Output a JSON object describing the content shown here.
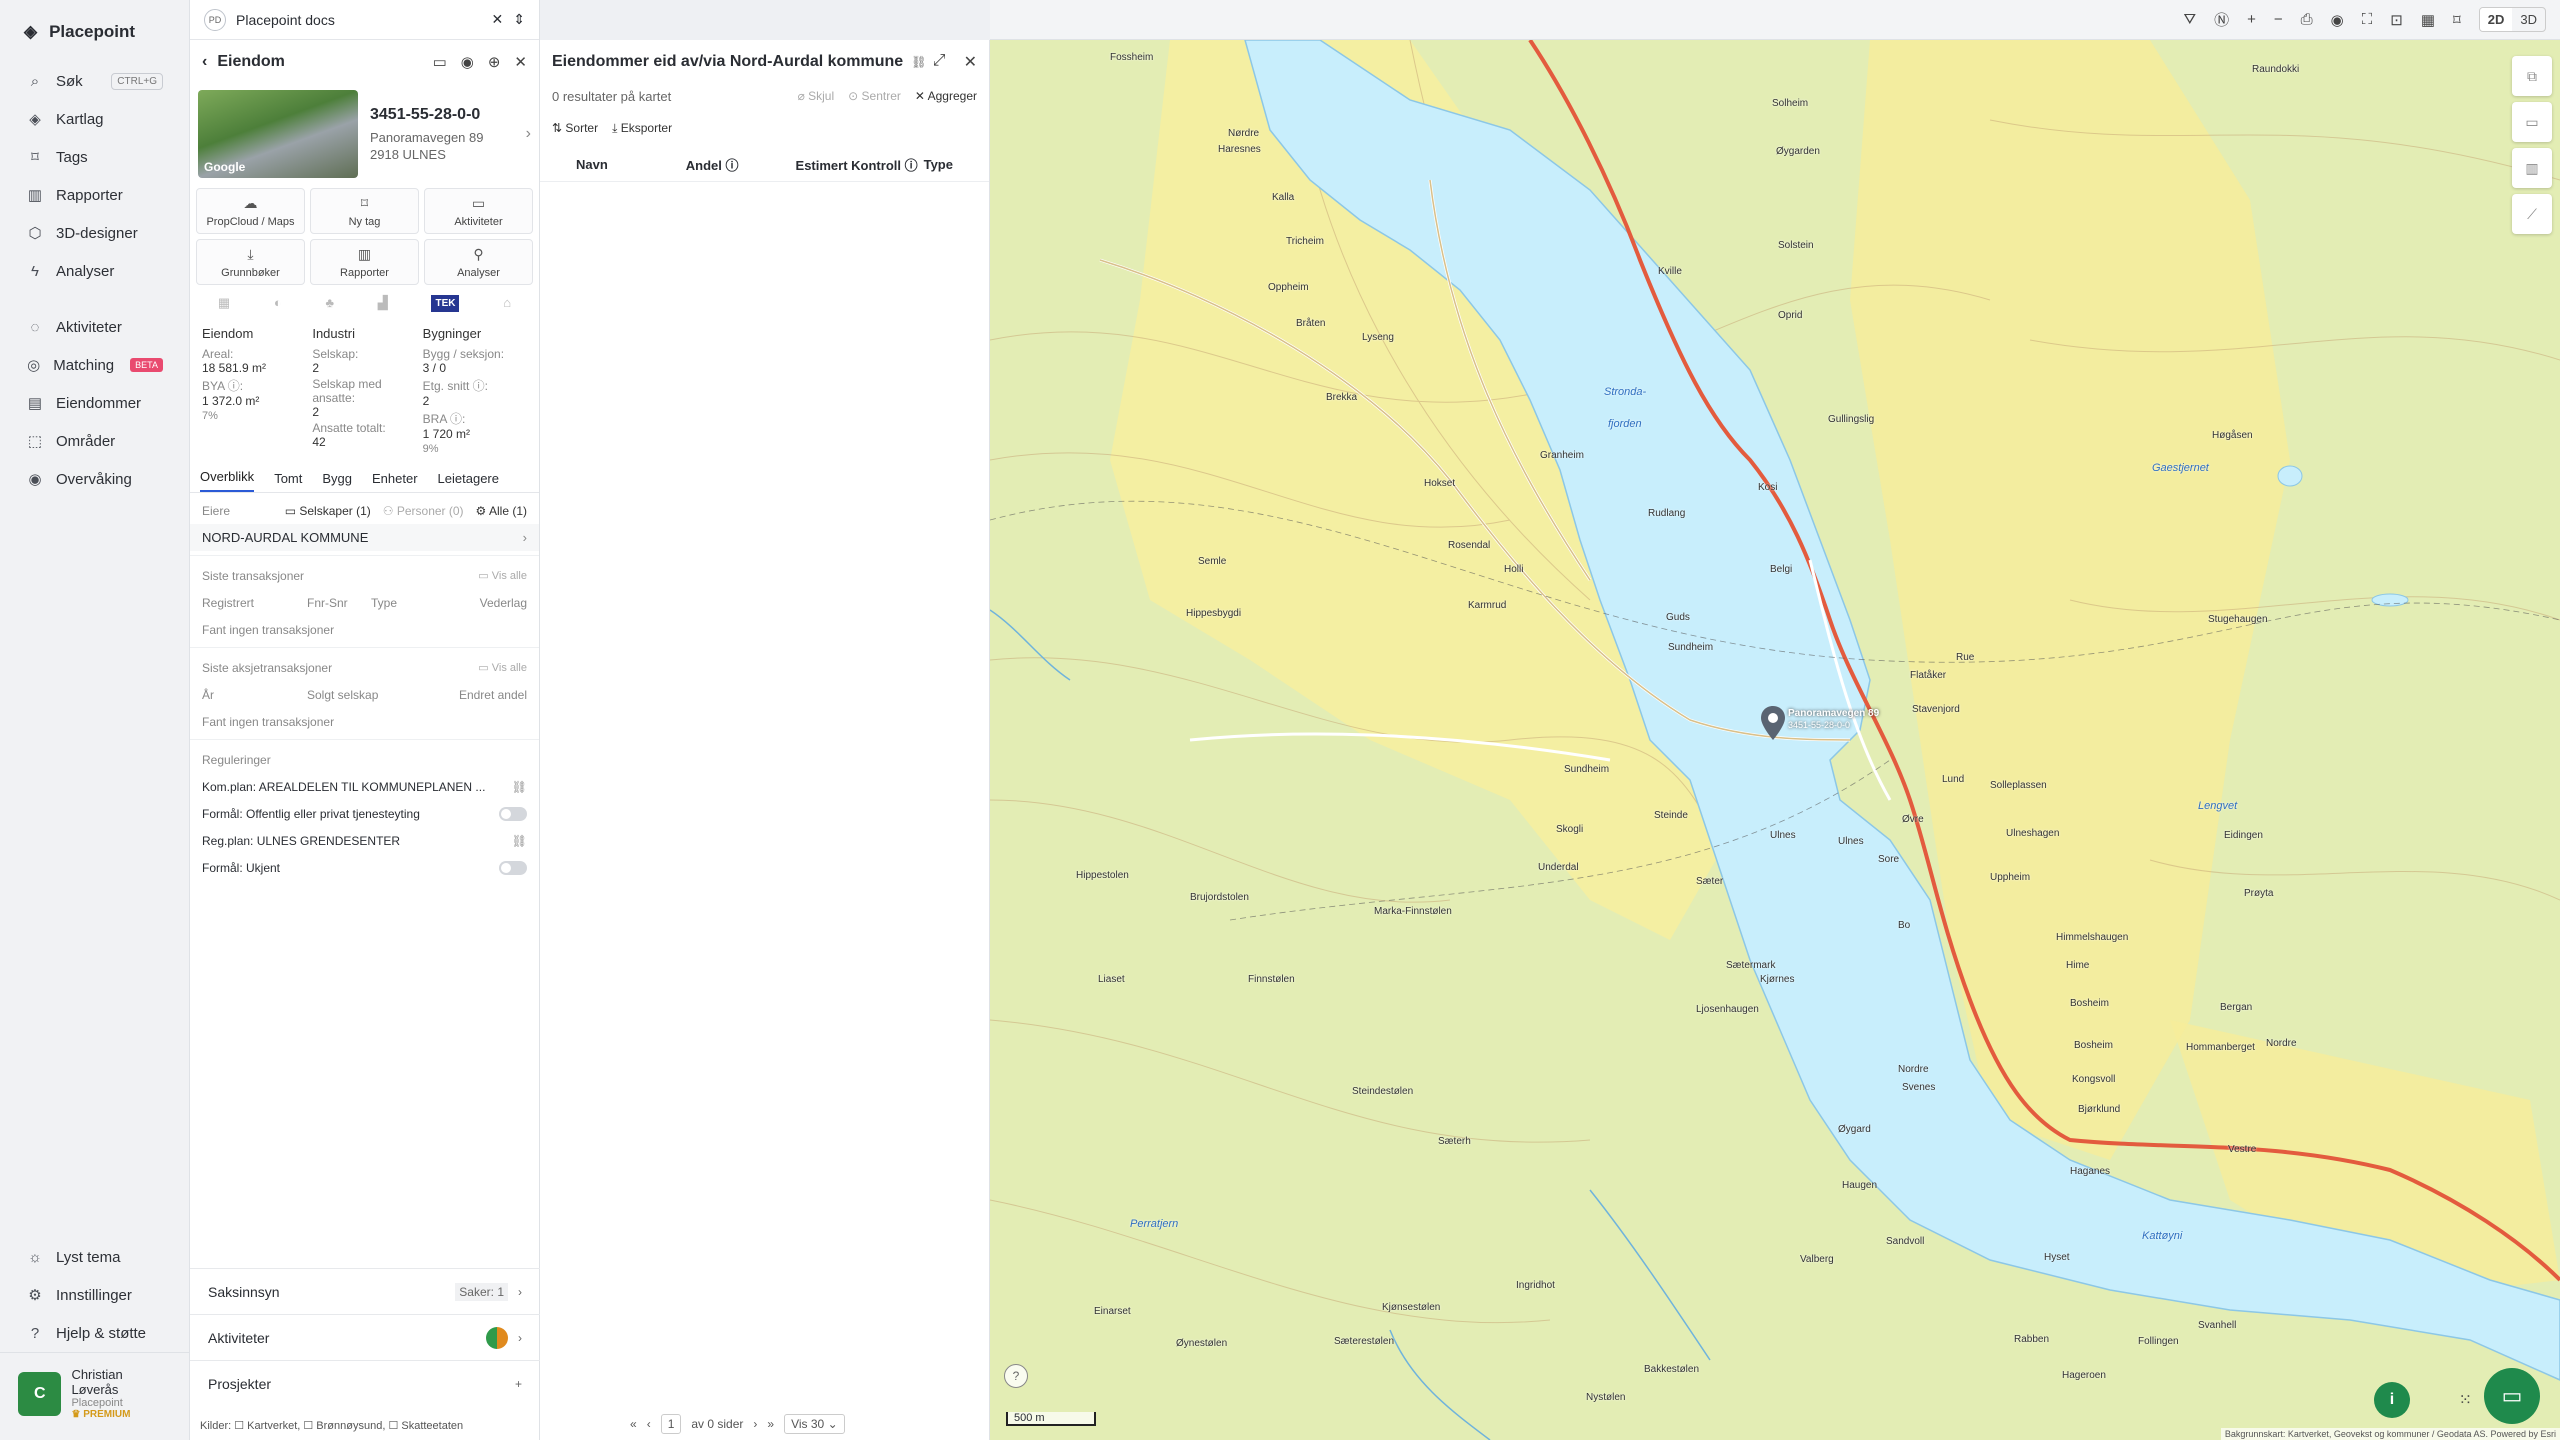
{
  "nav": {
    "brand": "Placepoint",
    "items": [
      {
        "icon": "search-icon",
        "label": "Søk",
        "kbd": "CTRL+G"
      },
      {
        "icon": "layers-icon",
        "label": "Kartlag"
      },
      {
        "icon": "bookmark-icon",
        "label": "Tags"
      },
      {
        "icon": "chart-icon",
        "label": "Rapporter"
      },
      {
        "icon": "cube-icon",
        "label": "3D-designer"
      },
      {
        "icon": "bolt-icon",
        "label": "Analyser"
      }
    ],
    "items2": [
      {
        "icon": "chat-icon",
        "label": "Aktiviteter"
      },
      {
        "icon": "target-icon",
        "label": "Matching",
        "badge": "BETA"
      },
      {
        "icon": "building-icon",
        "label": "Eiendommer"
      },
      {
        "icon": "area-icon",
        "label": "Områder"
      },
      {
        "icon": "eye-icon",
        "label": "Overvåking"
      }
    ],
    "bottom": [
      {
        "icon": "sun-icon",
        "label": "Lyst tema"
      },
      {
        "icon": "gear-icon",
        "label": "Innstillinger"
      },
      {
        "icon": "help-icon",
        "label": "Hjelp & støtte"
      }
    ],
    "user": {
      "initial": "C",
      "name": "Christian Løverås",
      "org": "Placepoint",
      "plan": "PREMIUM"
    }
  },
  "workspace": {
    "initials": "PD",
    "name": "Placepoint docs"
  },
  "property": {
    "title": "Eiendom",
    "photo_label": "Google",
    "id": "3451-55-28-0-0",
    "street": "Panoramavegen 89",
    "postal": "2918 ULNES",
    "buttons": [
      "PropCloud / Maps",
      "Ny tag",
      "Aktiviteter",
      "Grunnbøker",
      "Rapporter",
      "Analyser"
    ],
    "logo_tek": "TEK",
    "stats": {
      "c1": {
        "title": "Eiendom",
        "l1": "Areal:",
        "v1": "18 581.9 m²",
        "l2": "BYA ⓘ:",
        "v2": "1 372.0 m²",
        "p2": "7%"
      },
      "c2": {
        "title": "Industri",
        "l1": "Selskap:",
        "v1": "2",
        "l2": "Selskap med ansatte:",
        "v2": "2",
        "l3": "Ansatte totalt:",
        "v3": "42"
      },
      "c3": {
        "title": "Bygninger",
        "l1": "Bygg / seksjon:",
        "v1": "3 / 0",
        "l2": "Etg. snitt ⓘ:",
        "v2": "2",
        "l3": "BRA ⓘ:",
        "v3": "1 720 m²",
        "p3": "9%"
      }
    },
    "tabs": [
      "Overblikk",
      "Tomt",
      "Bygg",
      "Enheter",
      "Leietagere"
    ],
    "owners": {
      "label": "Eiere",
      "f1": "Selskaper (1)",
      "f2": "Personer (0)",
      "f3": "Alle (1)",
      "name": "NORD-AURDAL KOMMUNE"
    },
    "tx": {
      "title": "Siste transaksjoner",
      "vis": "Vis alle",
      "cols": [
        "Registrert",
        "Fnr-Snr",
        "Type",
        "Vederlag"
      ],
      "empty": "Fant ingen transaksjoner"
    },
    "stx": {
      "title": "Siste aksjetransaksjoner",
      "vis": "Vis alle",
      "cols": [
        "År",
        "Solgt selskap",
        "Endret andel"
      ],
      "empty": "Fant ingen transaksjoner"
    },
    "reg": {
      "title": "Reguleringer",
      "r1": "Kom.plan: AREALDELEN TIL KOMMUNEPLANEN ...",
      "r2": "Formål: Offentlig eller privat tjenesteyting",
      "r3": "Reg.plan: ULNES GRENDESENTER",
      "r4": "Formål: Ukjent"
    },
    "acc": {
      "a1": "Saksinnsyn",
      "a1r": "Saker: 1",
      "a2": "Aktiviteter",
      "a3": "Prosjekter"
    },
    "kilder": "Kilder: ☐ Kartverket, ☐ Brønnøysund, ☐ Skatteetaten"
  },
  "results": {
    "title": "Eiendommer eid av/via Nord-Aurdal kommune",
    "count": "0 resultater på kartet",
    "hide": "Skjul",
    "center": "Sentrer",
    "agg": "Aggreger",
    "sort": "Sorter",
    "export": "Eksporter",
    "cols": [
      "Navn",
      "Andel ⓘ",
      "Estimert Kontroll ⓘ",
      "Type"
    ],
    "pager": {
      "page": "1",
      "of": "av 0 sider",
      "vis": "Vis 30"
    }
  },
  "toolbar": {
    "d2": "2D",
    "d3": "3D"
  },
  "map": {
    "scale": "500 m",
    "attribution": "Bakgrunnskart: Kartverket, Geovekst og kommuner / Geodata AS. Powered by Esri",
    "marker": "Panoramavegen 89",
    "marker2": "3451-55-28-0-0",
    "places": [
      [
        "Fossheim",
        120,
        12
      ],
      [
        "Nørdre",
        238,
        88
      ],
      [
        "Haresnes",
        228,
        104
      ],
      [
        "Kalla",
        282,
        152
      ],
      [
        "Tricheim",
        296,
        196
      ],
      [
        "Oppheim",
        278,
        242
      ],
      [
        "Bråten",
        306,
        278
      ],
      [
        "Lyseng",
        372,
        292
      ],
      [
        "Brekka",
        336,
        352
      ],
      [
        "Hokset",
        434,
        438
      ],
      [
        "Granheim",
        550,
        410
      ],
      [
        "Holli",
        514,
        524
      ],
      [
        "Rosendal",
        458,
        500
      ],
      [
        "Karmrud",
        478,
        560
      ],
      [
        "Semle",
        208,
        516
      ],
      [
        "Hippesbygdi",
        196,
        568
      ],
      [
        "Sundheim",
        574,
        724
      ],
      [
        "Skogli",
        566,
        784
      ],
      [
        "Steinde",
        664,
        770
      ],
      [
        "Underdal",
        548,
        822
      ],
      [
        "Hippestolen",
        86,
        830
      ],
      [
        "Brujordstolen",
        200,
        852
      ],
      [
        "Marka-Finnstølen",
        384,
        866
      ],
      [
        "Finnstølen",
        258,
        934
      ],
      [
        "Liaset",
        108,
        934
      ],
      [
        "Steindestølen",
        362,
        1046
      ],
      [
        "Sæterh",
        448,
        1096
      ],
      [
        "Einarset",
        104,
        1266
      ],
      [
        "Kjønsestølen",
        392,
        1262
      ],
      [
        "Øynestølen",
        186,
        1298
      ],
      [
        "Sæterestølen",
        344,
        1296
      ],
      [
        "Ingridhot",
        526,
        1240
      ],
      [
        "Bakkestølen",
        654,
        1324
      ],
      [
        "Nystølen",
        596,
        1352
      ],
      [
        "Solheim",
        782,
        58
      ],
      [
        "Øygarden",
        786,
        106
      ],
      [
        "Solstein",
        788,
        200
      ],
      [
        "Kville",
        668,
        226
      ],
      [
        "Oprid",
        788,
        270
      ],
      [
        "Gullingslig",
        838,
        374
      ],
      [
        "Kosi",
        768,
        442
      ],
      [
        "Rudlang",
        658,
        468
      ],
      [
        "Belgi",
        780,
        524
      ],
      [
        "Guds",
        676,
        572
      ],
      [
        "Sundheim",
        678,
        602
      ],
      [
        "Flatåker",
        920,
        630
      ],
      [
        "Rue",
        966,
        612
      ],
      [
        "Stavenjord",
        922,
        664
      ],
      [
        "Lund",
        952,
        734
      ],
      [
        "Solleplassen",
        1000,
        740
      ],
      [
        "Øvre",
        912,
        774
      ],
      [
        "Ulnes",
        848,
        796
      ],
      [
        "Ulneshagen",
        1016,
        788
      ],
      [
        "Ulnes",
        780,
        790
      ],
      [
        "Sore",
        888,
        814
      ],
      [
        "Uppheim",
        1000,
        832
      ],
      [
        "Sæter",
        706,
        836
      ],
      [
        "Bo",
        908,
        880
      ],
      [
        "Sætermark",
        736,
        920
      ],
      [
        "Kjørnes",
        770,
        934
      ],
      [
        "Ljosenhaugen",
        706,
        964
      ],
      [
        "Himmelshaugen",
        1066,
        892
      ],
      [
        "Hime",
        1076,
        920
      ],
      [
        "Bosheim",
        1080,
        958
      ],
      [
        "Bosheim",
        1084,
        1000
      ],
      [
        "Kongsvoll",
        1082,
        1034
      ],
      [
        "Bjørklund",
        1088,
        1064
      ],
      [
        "Nordre",
        908,
        1024
      ],
      [
        "Svenes",
        912,
        1042
      ],
      [
        "Øygard",
        848,
        1084
      ],
      [
        "Haugen",
        852,
        1140
      ],
      [
        "Sandvoll",
        896,
        1196
      ],
      [
        "Hyset",
        1054,
        1212
      ],
      [
        "Valberg",
        810,
        1214
      ],
      [
        "Haganes",
        1080,
        1126
      ],
      [
        "Rabben",
        1024,
        1294
      ],
      [
        "Hageroen",
        1072,
        1330
      ],
      [
        "Hommanberget",
        1196,
        1002
      ],
      [
        "Bergan",
        1230,
        962
      ],
      [
        "Nordre",
        1276,
        998
      ],
      [
        "Vestre",
        1238,
        1104
      ],
      [
        "Svanhell",
        1208,
        1280
      ],
      [
        "Follingen",
        1148,
        1296
      ],
      [
        "Raundokki",
        1262,
        24
      ],
      [
        "Høgåsen",
        1222,
        390
      ],
      [
        "Stugehaugen",
        1218,
        574
      ],
      [
        "Eidingen",
        1234,
        790
      ],
      [
        "Prøyta",
        1254,
        848
      ]
    ],
    "water": [
      [
        "Stronda-",
        614,
        346
      ],
      [
        "fjorden",
        618,
        378
      ],
      [
        "Gaestjernet",
        1162,
        422
      ],
      [
        "Lengvet",
        1208,
        760
      ],
      [
        "Perratjern",
        140,
        1178
      ],
      [
        "Kattøyni",
        1152,
        1190
      ]
    ]
  }
}
